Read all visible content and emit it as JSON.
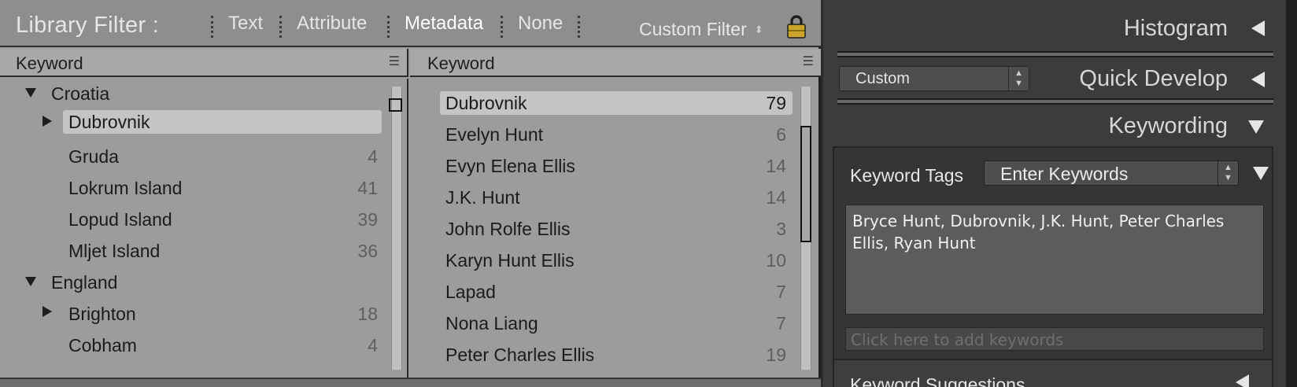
{
  "filter_bar": {
    "title": "Library Filter :",
    "tabs": [
      "Text",
      "Attribute",
      "Metadata",
      "None"
    ],
    "active_tab": "Metadata",
    "custom_filter": "Custom Filter"
  },
  "column1": {
    "header": "Keyword",
    "rows": [
      {
        "label": "Croatia",
        "count": "",
        "level": 0,
        "expander": "down"
      },
      {
        "label": "Dubrovnik",
        "count": "",
        "level": 1,
        "expander": "right",
        "selected": true
      },
      {
        "label": "Gruda",
        "count": "4",
        "level": 1
      },
      {
        "label": "Lokrum Island",
        "count": "41",
        "level": 1
      },
      {
        "label": "Lopud Island",
        "count": "39",
        "level": 1
      },
      {
        "label": "Mljet Island",
        "count": "36",
        "level": 1
      },
      {
        "label": "England",
        "count": "",
        "level": 0,
        "expander": "down"
      },
      {
        "label": "Brighton",
        "count": "18",
        "level": 1,
        "expander": "right"
      },
      {
        "label": "Cobham",
        "count": "4",
        "level": 1
      }
    ]
  },
  "column2": {
    "header": "Keyword",
    "rows": [
      {
        "label": "Dubrovnik",
        "count": "79",
        "selected": true
      },
      {
        "label": "Evelyn Hunt",
        "count": "6"
      },
      {
        "label": "Evyn Elena Ellis",
        "count": "14"
      },
      {
        "label": "J.K. Hunt",
        "count": "14"
      },
      {
        "label": "John Rolfe Ellis",
        "count": "3"
      },
      {
        "label": "Karyn Hunt Ellis",
        "count": "10"
      },
      {
        "label": "Lapad",
        "count": "7"
      },
      {
        "label": "Nona Liang",
        "count": "7"
      },
      {
        "label": "Peter Charles Ellis",
        "count": "19"
      }
    ]
  },
  "right_panel": {
    "histogram": "Histogram",
    "quick_develop": "Quick Develop",
    "quick_develop_preset": "Custom",
    "keywording": "Keywording",
    "keyword_tags_label": "Keyword Tags",
    "keyword_tags_mode": "Enter Keywords",
    "keywords_text": "Bryce Hunt, Dubrovnik, J.K. Hunt, Peter Charles Ellis, Ryan Hunt",
    "add_keywords_placeholder": "Click here to add keywords",
    "keyword_suggestions": "Keyword Suggestions"
  },
  "colors": {
    "filter_bg": "#8e8e8e",
    "list_bg": "#9c9c9c",
    "selection": "#c4c4c4",
    "panel_bg": "#3c3c3c",
    "lock_gold": "#c9a227"
  },
  "icons": [
    "lock-icon",
    "disclosure-triangle-icon",
    "column-menu-icon",
    "stepper-arrows-icon",
    "collapse-triangle-icon"
  ]
}
